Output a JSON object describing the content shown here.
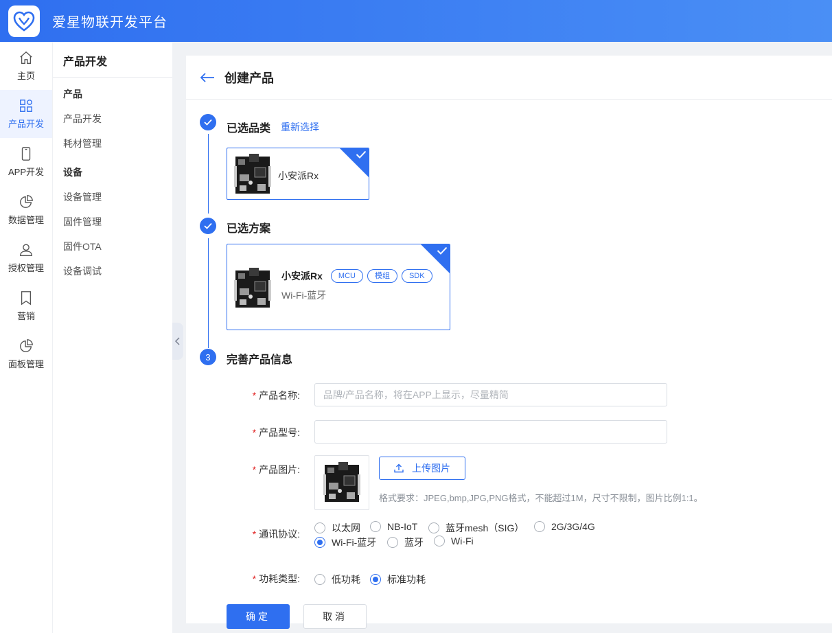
{
  "app": {
    "title": "爱星物联开发平台"
  },
  "rail": {
    "items": [
      {
        "label": "主页",
        "icon": "home-icon"
      },
      {
        "label": "产品开发",
        "icon": "grid-icon",
        "active": true
      },
      {
        "label": "APP开发",
        "icon": "phone-icon"
      },
      {
        "label": "数据管理",
        "icon": "pie-chart-icon"
      },
      {
        "label": "授权管理",
        "icon": "user-icon"
      },
      {
        "label": "营销",
        "icon": "bookmark-icon"
      },
      {
        "label": "面板管理",
        "icon": "pie-chart-icon"
      }
    ]
  },
  "subnav": {
    "title": "产品开发",
    "group_product": "产品",
    "item_product_dev": "产品开发",
    "item_consumables": "耗材管理",
    "group_device": "设备",
    "item_device_mgmt": "设备管理",
    "item_firmware_mgmt": "固件管理",
    "item_firmware_ota": "固件OTA",
    "item_device_debug": "设备调试"
  },
  "page": {
    "title": "创建产品",
    "step1": {
      "title": "已选品类",
      "reselect": "重新选择",
      "category_name": "小安派Rx"
    },
    "step2": {
      "title": "已选方案",
      "scheme_name": "小安派Rx",
      "tags": [
        "MCU",
        "模组",
        "SDK"
      ],
      "scheme_desc": "Wi-Fi-蓝牙"
    },
    "step3": {
      "number": "3",
      "title": "完善产品信息"
    }
  },
  "form": {
    "name_label": "产品名称:",
    "name_placeholder": "品牌/产品名称，将在APP上显示，尽量精简",
    "name_value": "",
    "model_label": "产品型号:",
    "model_value": "",
    "image_label": "产品图片:",
    "upload_label": "上传图片",
    "upload_hint": "格式要求：JPEG,bmp,JPG,PNG格式，不能超过1M，尺寸不限制，图片比例1:1。",
    "protocol_label": "通讯协议:",
    "protocols": [
      "以太网",
      "NB-IoT",
      "蓝牙mesh（SIG）",
      "2G/3G/4G",
      "Wi-Fi-蓝牙",
      "蓝牙",
      "Wi-Fi"
    ],
    "protocol_selected": "Wi-Fi-蓝牙",
    "power_label": "功耗类型:",
    "power_options": [
      "低功耗",
      "标准功耗"
    ],
    "power_selected": "标准功耗",
    "confirm": "确定",
    "cancel": "取消"
  },
  "colors": {
    "primary": "#2f6ff0",
    "required": "#e02020"
  }
}
